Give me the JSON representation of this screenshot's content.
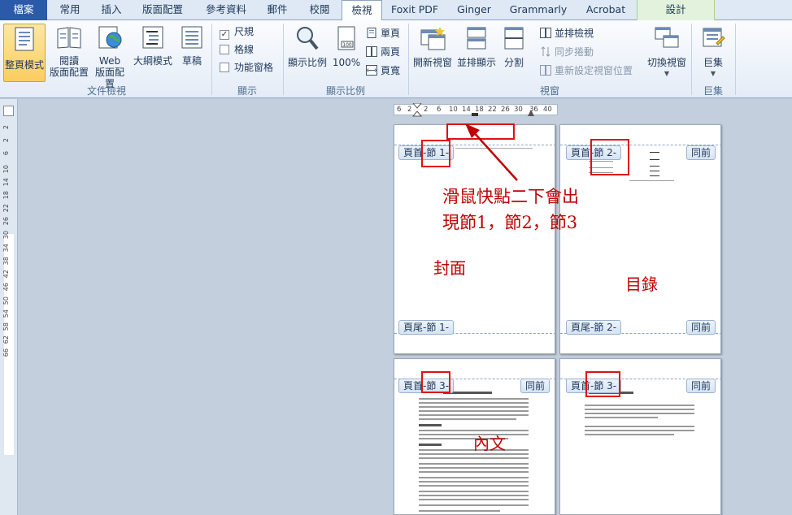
{
  "tabs": [
    "檔案",
    "常用",
    "插入",
    "版面配置",
    "參考資料",
    "郵件",
    "校閱",
    "檢視",
    "Foxit PDF",
    "Ginger",
    "Grammarly",
    "Acrobat",
    "設計"
  ],
  "active_tab": "檢視",
  "ribbon": {
    "doc_views": {
      "group_label": "文件檢視",
      "print_layout": "整頁模式",
      "full_screen_reading_1": "閱讀",
      "full_screen_reading_2": "版面配置",
      "web_layout_1": "Web",
      "web_layout_2": "版面配置",
      "outline": "大綱模式",
      "draft": "草稿"
    },
    "show": {
      "group_label": "顯示",
      "ruler": "尺規",
      "ruler_checked": true,
      "gridlines": "格線",
      "gridlines_checked": false,
      "nav_pane": "功能窗格",
      "nav_pane_checked": false
    },
    "zoom": {
      "group_label": "顯示比例",
      "zoom_button": "顯示比例",
      "hundred_percent": "100%",
      "one_page": "單頁",
      "two_pages": "兩頁",
      "page_width": "頁寬"
    },
    "window": {
      "group_label": "視窗",
      "new_window": "開新視窗",
      "arrange_all": "並排顯示",
      "split": "分割",
      "view_side_by_side": "並排檢視",
      "sync_scroll": "同步捲動",
      "reset_window": "重新設定視窗位置",
      "switch_windows": "切換視窗"
    },
    "macros": {
      "group_label": "巨集",
      "macros_button": "巨集"
    }
  },
  "ruler": {
    "h_numbers": [
      "6",
      "2",
      "2",
      "6",
      "10",
      "14",
      "18",
      "22",
      "26",
      "30",
      "36",
      "40"
    ],
    "v_numbers": [
      "2",
      "2",
      "6",
      "10",
      "14",
      "18",
      "22",
      "26",
      "30",
      "34",
      "38",
      "42",
      "46",
      "50",
      "54",
      "58",
      "62",
      "66"
    ]
  },
  "pages": {
    "p1_header": "頁首-節 1-",
    "p1_footer": "頁尾-節 1-",
    "p2_header": "頁首-節 2-",
    "p2_footer": "頁尾-節 2-",
    "p2_same_prev_top": "同前",
    "p2_same_prev_bottom": "同前",
    "p3_header": "頁首-節 3-",
    "p3_same_prev": "同前",
    "p4_header": "頁首-節 3-",
    "p4_same_prev": "同前"
  },
  "annotations": {
    "note_line1": "滑鼠快點二下會出",
    "note_line2": "現節1，節2，節3",
    "cover": "封面",
    "toc": "目錄",
    "body": "內文"
  },
  "colors": {
    "file_tab": "#2a5aa8",
    "annotation": "#c00000",
    "redbox": "#e01010",
    "workspace": "#c4cfdd"
  }
}
